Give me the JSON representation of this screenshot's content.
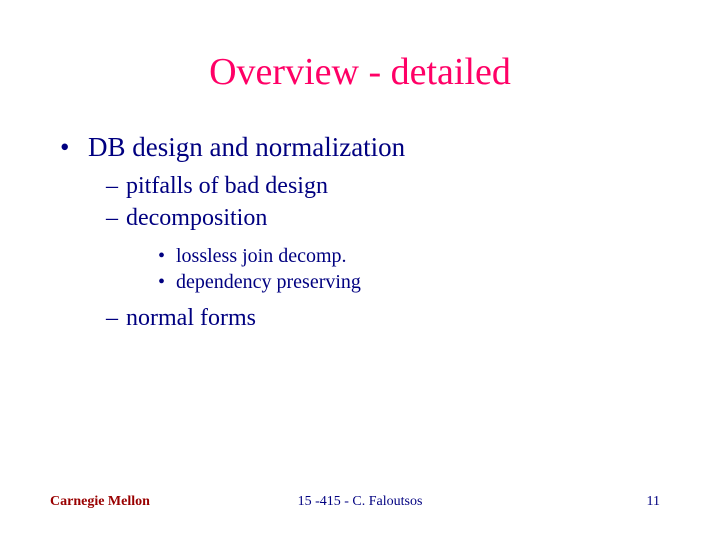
{
  "title": "Overview - detailed",
  "bullets": {
    "l1_0": "DB design and normalization",
    "l2_0": "pitfalls of bad design",
    "l2_1": "decomposition",
    "l3_0": "lossless join decomp.",
    "l3_1": "dependency preserving",
    "l2_2": "normal forms"
  },
  "footer": {
    "left": "Carnegie Mellon",
    "center": "15 -415 - C. Faloutsos",
    "right": "11"
  }
}
